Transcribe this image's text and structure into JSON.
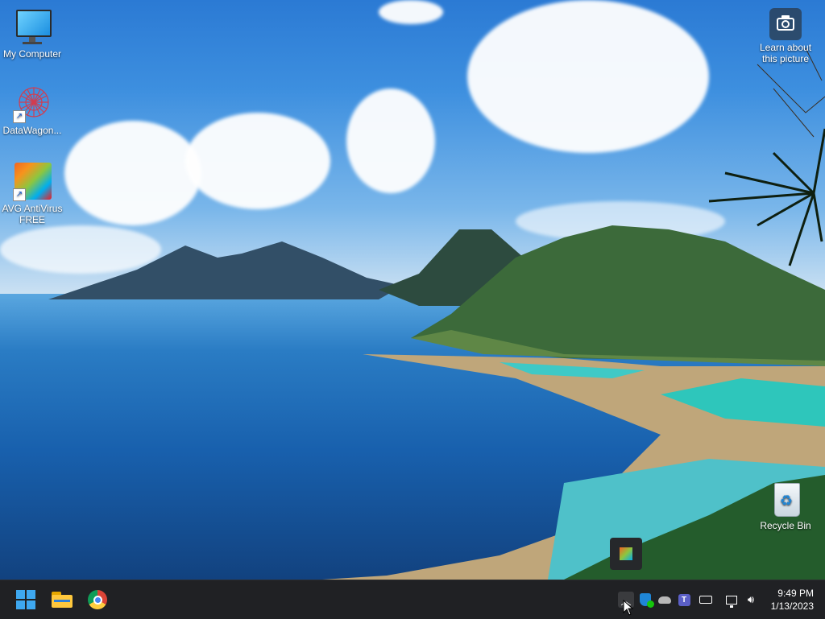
{
  "desktop_icons": [
    {
      "label": "My Computer"
    },
    {
      "label": "DataWagon..."
    },
    {
      "label": "AVG AntiVirus FREE"
    },
    {
      "label": "Recycle Bin"
    }
  ],
  "spotlight": {
    "label": "Learn about this picture"
  },
  "taskbar": {
    "apps": [
      "start-icon",
      "file-explorer-icon",
      "chrome-icon"
    ],
    "tray_icons": [
      "show-hidden-icons-chevron",
      "defender-icon",
      "onedrive-icon",
      "teams-icon",
      "keyboard-icon",
      "network-icon",
      "volume-icon"
    ]
  },
  "clock": {
    "time": "9:49 PM",
    "date": "1/13/2023"
  },
  "colors": {
    "taskbar": "#202124",
    "accent": "#0078d4"
  }
}
